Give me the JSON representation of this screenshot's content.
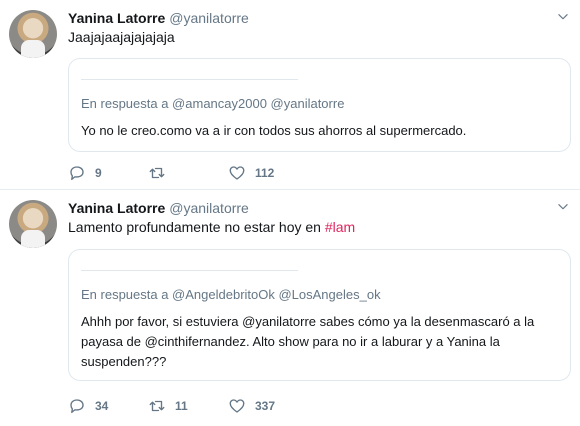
{
  "tweets": [
    {
      "author": {
        "name": "Yanina Latorre",
        "handle": "@yanilatorre"
      },
      "text": "Jaajajaajajajajaja",
      "quote": {
        "reply_to": "En respuesta a @amancay2000 @yanilatorre",
        "text": "Yo no le creo.como va a ir con todos sus ahorros al supermercado."
      },
      "counts": {
        "replies": "9",
        "retweets": "",
        "likes": "112"
      }
    },
    {
      "author": {
        "name": "Yanina Latorre",
        "handle": "@yanilatorre"
      },
      "text": "Lamento profundamente no estar hoy en ",
      "hashtag": "#lam",
      "quote": {
        "reply_to": "En respuesta a @AngeldebritoOk @LosAngeles_ok",
        "text": "Ahhh por favor, si estuviera @yanilatorre sabes cómo ya la desenmascaró a la payasa de @cinthifernandez. Alto show para no ir a laburar y a Yanina la suspenden???"
      },
      "counts": {
        "replies": "34",
        "retweets": "11",
        "likes": "337"
      }
    }
  ],
  "icons": {
    "avatar": "profile-photo",
    "more": "chevron-down-icon",
    "reply": "reply-icon",
    "retweet": "retweet-icon",
    "like": "heart-icon"
  },
  "colors": {
    "text": "#14171a",
    "secondary": "#657786",
    "hashtag": "#e0245e",
    "border": "#e1e8ed"
  }
}
